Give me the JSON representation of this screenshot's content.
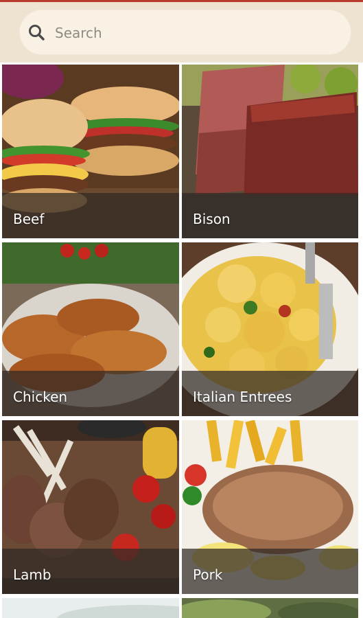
{
  "search": {
    "placeholder": "Search",
    "icon": "search-icon"
  },
  "categories": [
    {
      "label": "Beef"
    },
    {
      "label": "Bison"
    },
    {
      "label": "Chicken"
    },
    {
      "label": "Italian Entrees"
    },
    {
      "label": "Lamb"
    },
    {
      "label": "Pork"
    }
  ]
}
